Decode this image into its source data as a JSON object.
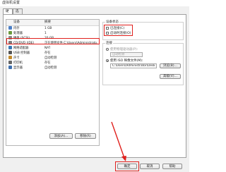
{
  "window": {
    "title": "虚拟机设置"
  },
  "tabs": [
    {
      "label": "硬件"
    },
    {
      "label": "选项"
    }
  ],
  "hardware_table": {
    "col_device": "设备",
    "col_summary": "摘要",
    "rows": [
      {
        "device": "内存",
        "summary": "1 GB",
        "icon": "memory-icon",
        "color": "#4c7fc7"
      },
      {
        "device": "处理器",
        "summary": "1",
        "icon": "cpu-icon",
        "color": "#6b9a3d"
      },
      {
        "device": "硬盘 (SCSI)",
        "summary": "20 GB",
        "icon": "harddisk-icon",
        "color": "#8a8a8a"
      },
      {
        "device": "CD/DVD (IDE)",
        "summary": "正在使用文件 C:\\Users\\Administrato...",
        "icon": "cdrom-icon",
        "color": "#7d7d7d"
      },
      {
        "device": "网络适配器",
        "summary": "NAT",
        "icon": "network-icon",
        "color": "#3b78b5"
      },
      {
        "device": "USB 控制器",
        "summary": "存在",
        "icon": "usb-icon",
        "color": "#555555"
      },
      {
        "device": "声卡",
        "summary": "自动检测",
        "icon": "sound-icon",
        "color": "#c48a2a"
      },
      {
        "device": "打印机",
        "summary": "存在",
        "icon": "printer-icon",
        "color": "#666666"
      },
      {
        "device": "显示器",
        "summary": "自动检测",
        "icon": "display-icon",
        "color": "#3d6fb0"
      }
    ]
  },
  "buttons": {
    "add": "添加(A)...",
    "remove": "移除(R)",
    "ok": "确定",
    "cancel": "取消",
    "help": "帮助",
    "browse": "浏览(B)...",
    "advanced": "高级(V)..."
  },
  "device_status": {
    "title": "设备状态",
    "connected": "已连接(C)",
    "connect_at_power_on": "启动时连接(O)"
  },
  "connection": {
    "title": "连接",
    "physical_drive": "使用物理驱动器(P):",
    "auto_detect": "自动检测",
    "iso_image": "使用 ISO 映像文件(M):",
    "iso_path": "C:\\Users\\Administrator\\Desk"
  },
  "colors": {
    "highlight": "#e0201d"
  }
}
